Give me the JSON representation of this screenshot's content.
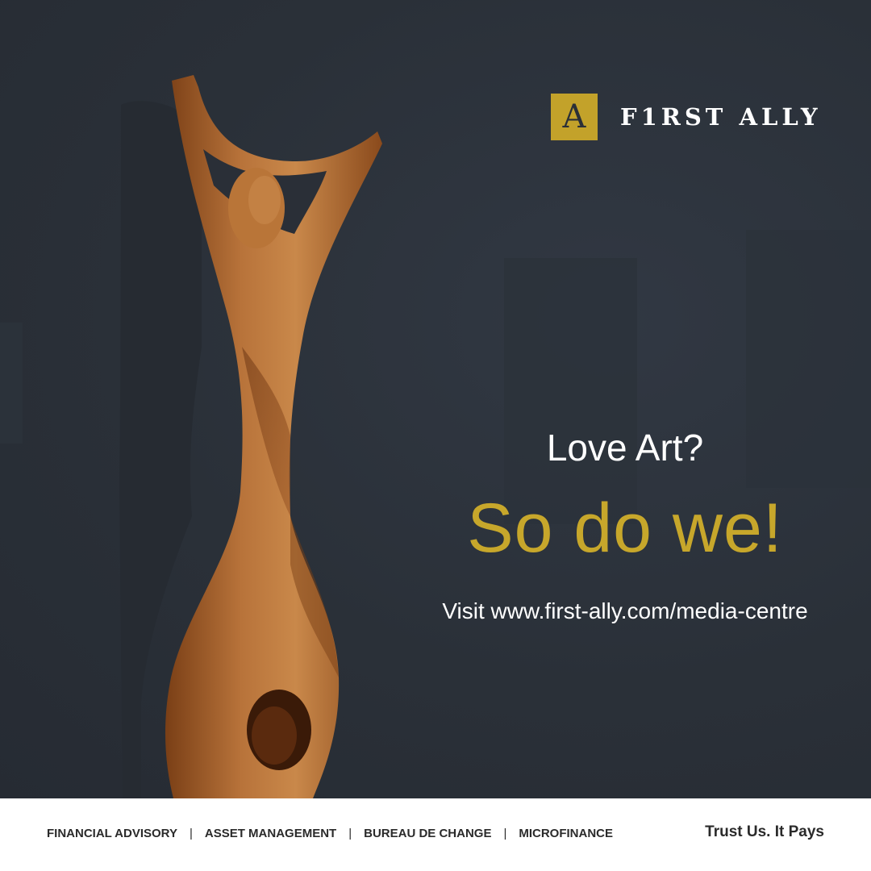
{
  "brand": {
    "logo_glyph": "A",
    "name": "F1RST ALLY",
    "accent_color": "#c3a22a"
  },
  "headline": {
    "question": "Love Art?",
    "answer": "So do we!",
    "visit": "Visit www.first-ally.com/media-centre"
  },
  "footer": {
    "services": [
      "FINANCIAL ADVISORY",
      "ASSET MANAGEMENT",
      "BUREAU DE CHANGE",
      "MICROFINANCE"
    ],
    "separator": "|",
    "tagline": "Trust Us. It Pays"
  },
  "colors": {
    "background": "#2a2f37",
    "highlight": "#c7a72b",
    "footer_bg": "#ffffff",
    "wood": "#b06a30"
  }
}
